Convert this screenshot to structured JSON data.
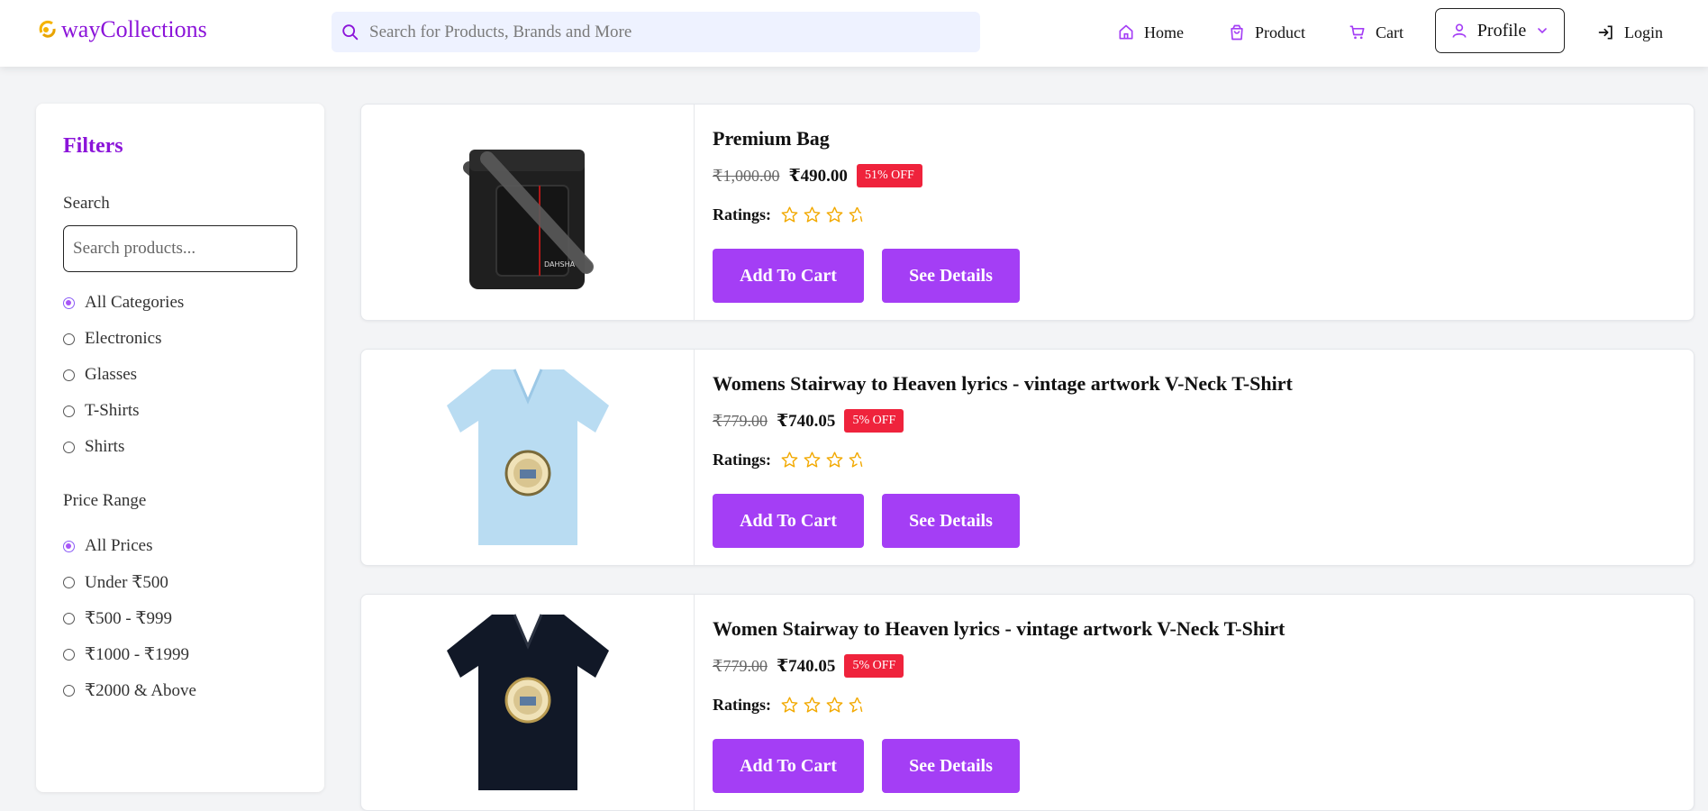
{
  "header": {
    "logo": "wayCollections",
    "search_placeholder": "Search for Products, Brands and More",
    "nav": {
      "home": "Home",
      "product": "Product",
      "cart": "Cart",
      "profile": "Profile",
      "login": "Login"
    },
    "accent_color": "#8b14d9"
  },
  "sidebar": {
    "title": "Filters",
    "search_label": "Search",
    "search_placeholder": "Search products...",
    "categories": [
      {
        "label": "All Categories",
        "selected": true
      },
      {
        "label": "Electronics",
        "selected": false
      },
      {
        "label": "Glasses",
        "selected": false
      },
      {
        "label": "T-Shirts",
        "selected": false
      },
      {
        "label": "Shirts",
        "selected": false
      }
    ],
    "price_label": "Price Range",
    "prices": [
      {
        "label": "All Prices",
        "selected": true
      },
      {
        "label": "Under ₹500",
        "selected": false
      },
      {
        "label": "₹500 - ₹999",
        "selected": false
      },
      {
        "label": "₹1000 - ₹1999",
        "selected": false
      },
      {
        "label": "₹2000 & Above",
        "selected": false
      }
    ]
  },
  "products": [
    {
      "title": "Premium Bag",
      "old_price": "₹1,000.00",
      "price": "₹490.00",
      "discount": "51% OFF",
      "ratings_label": "Ratings:",
      "rating": 3.5,
      "add_to_cart": "Add To Cart",
      "see_details": "See Details",
      "image": "black-shoulder-bag"
    },
    {
      "title": "Womens Stairway to Heaven lyrics - vintage artwork V-Neck T-Shirt",
      "old_price": "₹779.00",
      "price": "₹740.05",
      "discount": "5% OFF",
      "ratings_label": "Ratings:",
      "rating": 3.5,
      "add_to_cart": "Add To Cart",
      "see_details": "See Details",
      "image": "light-blue-tshirt"
    },
    {
      "title": "Women Stairway to Heaven lyrics - vintage artwork V-Neck T-Shirt",
      "old_price": "₹779.00",
      "price": "₹740.05",
      "discount": "5% OFF",
      "ratings_label": "Ratings:",
      "rating": 3.5,
      "add_to_cart": "Add To Cart",
      "see_details": "See Details",
      "image": "black-tshirt"
    }
  ]
}
